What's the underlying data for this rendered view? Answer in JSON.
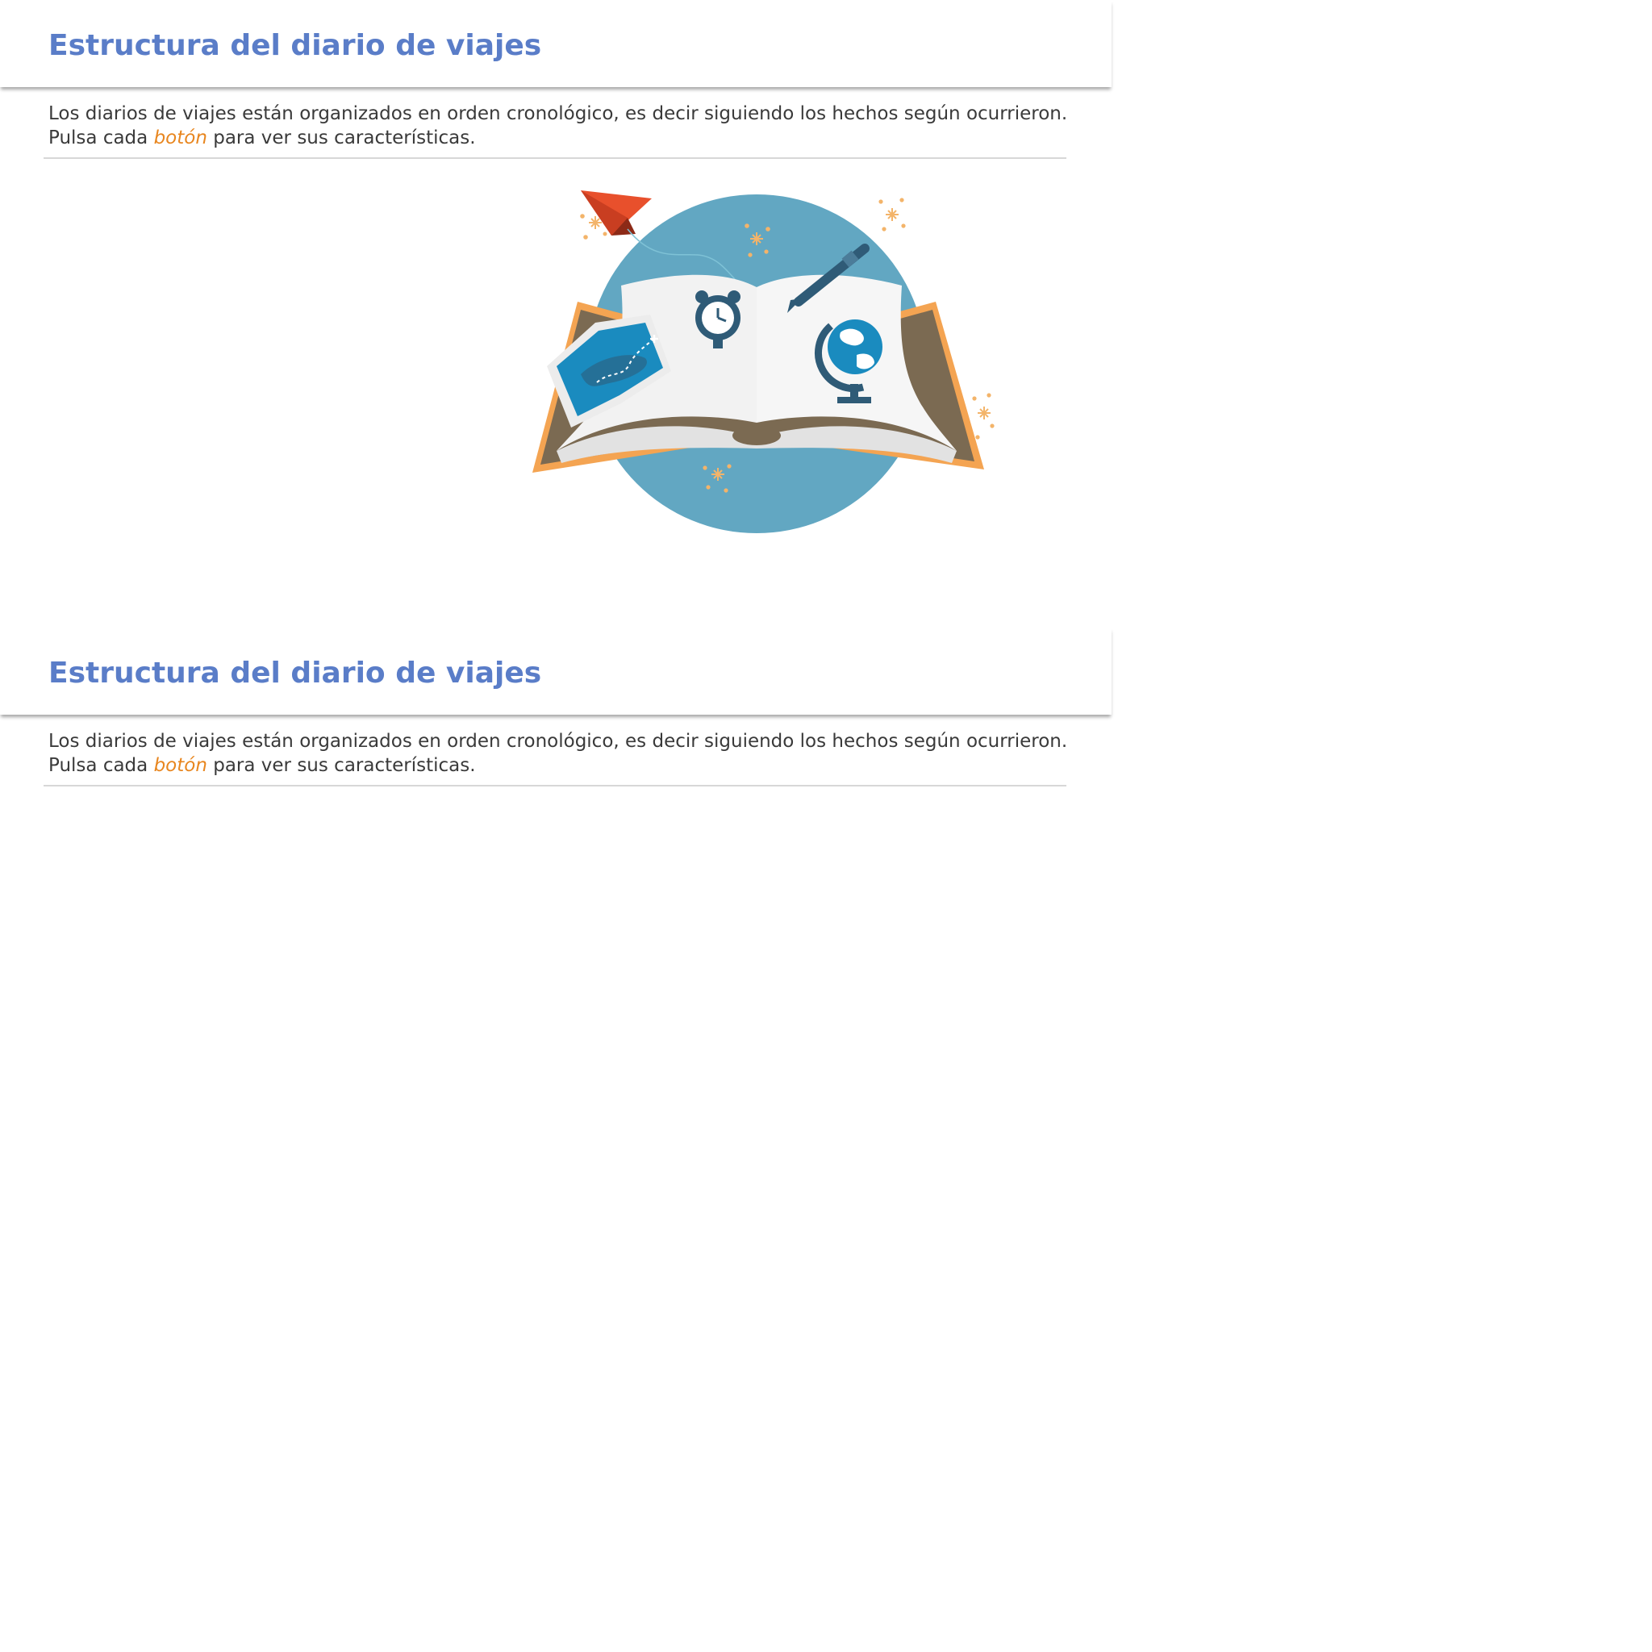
{
  "sections": [
    {
      "title": "Estructura del diario de viajes",
      "line1": "Los diarios de viajes están organizados en orden cronológico, es decir siguiendo los hechos según ocurrieron.",
      "line2_before": "Pulsa cada ",
      "line2_link": "botón",
      "line2_after": " para ver sus características."
    },
    {
      "title": "Estructura del diario de viajes",
      "line1": "Los diarios de viajes están organizados en orden cronológico, es decir siguiendo los hechos según ocurrieron.",
      "line2_before": "Pulsa cada ",
      "line2_link": "botón",
      "line2_after": " para ver sus características."
    }
  ],
  "illustration": {
    "icons": [
      "paper-plane-icon",
      "alarm-clock-icon",
      "fountain-pen-icon",
      "map-icon",
      "globe-icon",
      "open-book-icon",
      "sparkle-icon"
    ],
    "colors": {
      "circle": "#62a7c2",
      "book_cover": "#7b6a52",
      "book_edge": "#f4a452",
      "page": "#f5f5f5",
      "dark_blue": "#2f5b77",
      "plane": "#e8502c",
      "sparkle": "#f3b46a"
    }
  },
  "colors": {
    "title": "#5a7dc8",
    "accent": "#e8861f",
    "text": "#3a3a3a"
  }
}
